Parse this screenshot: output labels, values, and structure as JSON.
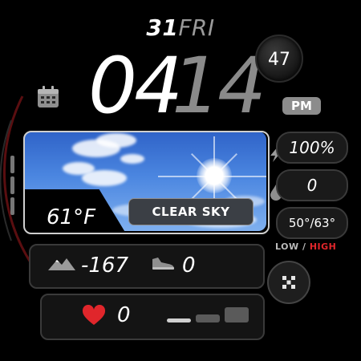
{
  "date": {
    "day_number": "31",
    "weekday": "FRI"
  },
  "time": {
    "hours": "04",
    "minutes": "14",
    "seconds": "47",
    "ampm": "PM"
  },
  "weather": {
    "temperature": "61°F",
    "condition": "CLEAR SKY",
    "low_high": "50°/63°",
    "low_label": "LOW",
    "separator": "/",
    "high_label": "HIGH"
  },
  "stats": {
    "battery": "100%",
    "precipitation": "0",
    "elevation": "-167",
    "steps": "0",
    "heart_rate": "0"
  },
  "icons": {
    "calendar": "calendar-icon",
    "battery": "lightning-icon",
    "precipitation": "drop-icon",
    "elevation": "mountain-icon",
    "steps": "shoe-icon",
    "heart": "heart-icon",
    "apps": "dots-icon"
  },
  "colors": {
    "accent_red": "#e0262b",
    "minutes_gray": "#8a8a8a",
    "ampm_bg": "#8c8c8c",
    "sky_blue": "#4b86e0"
  }
}
